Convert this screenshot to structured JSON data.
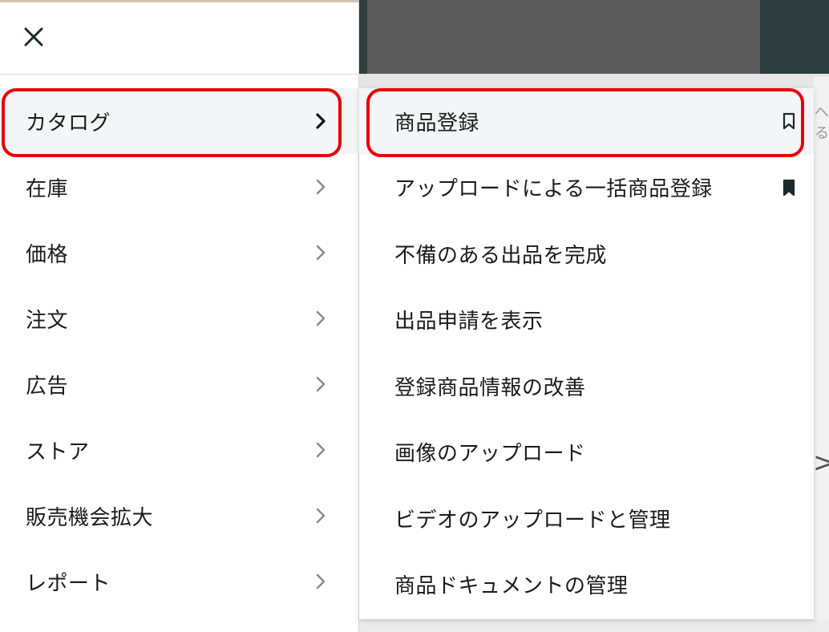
{
  "menu": {
    "close_label": "×",
    "categories": [
      {
        "label": "カタログ",
        "active": true
      },
      {
        "label": "在庫",
        "active": false
      },
      {
        "label": "価格",
        "active": false
      },
      {
        "label": "注文",
        "active": false
      },
      {
        "label": "広告",
        "active": false
      },
      {
        "label": "ストア",
        "active": false
      },
      {
        "label": "販売機会拡大",
        "active": false
      },
      {
        "label": "レポート",
        "active": false
      }
    ],
    "submenu": [
      {
        "label": "商品登録",
        "bookmark": "outline"
      },
      {
        "label": "アップロードによる一括商品登録",
        "bookmark": "filled"
      },
      {
        "label": "不備のある出品を完成",
        "bookmark": "none"
      },
      {
        "label": "出品申請を表示",
        "bookmark": "none"
      },
      {
        "label": "登録商品情報の改善",
        "bookmark": "none"
      },
      {
        "label": "画像のアップロード",
        "bookmark": "none"
      },
      {
        "label": "ビデオのアップロードと管理",
        "bookmark": "none"
      },
      {
        "label": "商品ドキュメントの管理",
        "bookmark": "none"
      }
    ]
  },
  "colors": {
    "highlight": "#e8000b",
    "text": "#1b1b1b",
    "active_bg": "#f3f5f7"
  },
  "background": {
    "partial_text": "へる"
  }
}
